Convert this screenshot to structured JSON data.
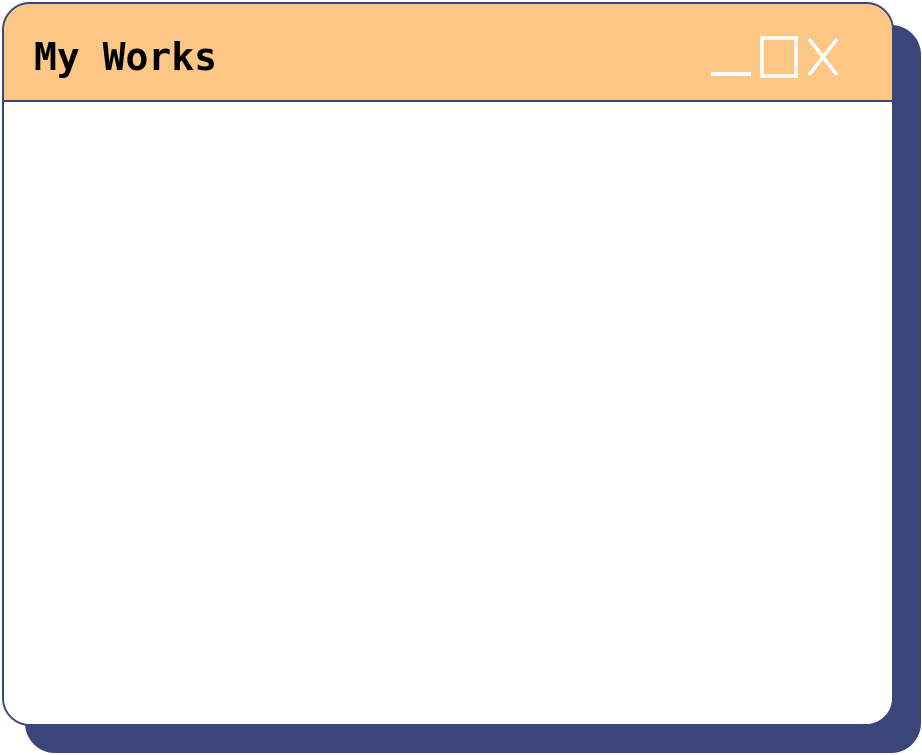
{
  "window": {
    "title": "My Works"
  },
  "controls": {
    "minimize_icon": "minimize-icon",
    "maximize_icon": "maximize-icon",
    "close_icon": "close-icon"
  },
  "colors": {
    "titlebar": "#fcc685",
    "border": "#3b4579",
    "shadow": "#3b4579",
    "window_bg": "#ffffff",
    "title_text": "#000000",
    "control_glyph": "#ffffff"
  }
}
